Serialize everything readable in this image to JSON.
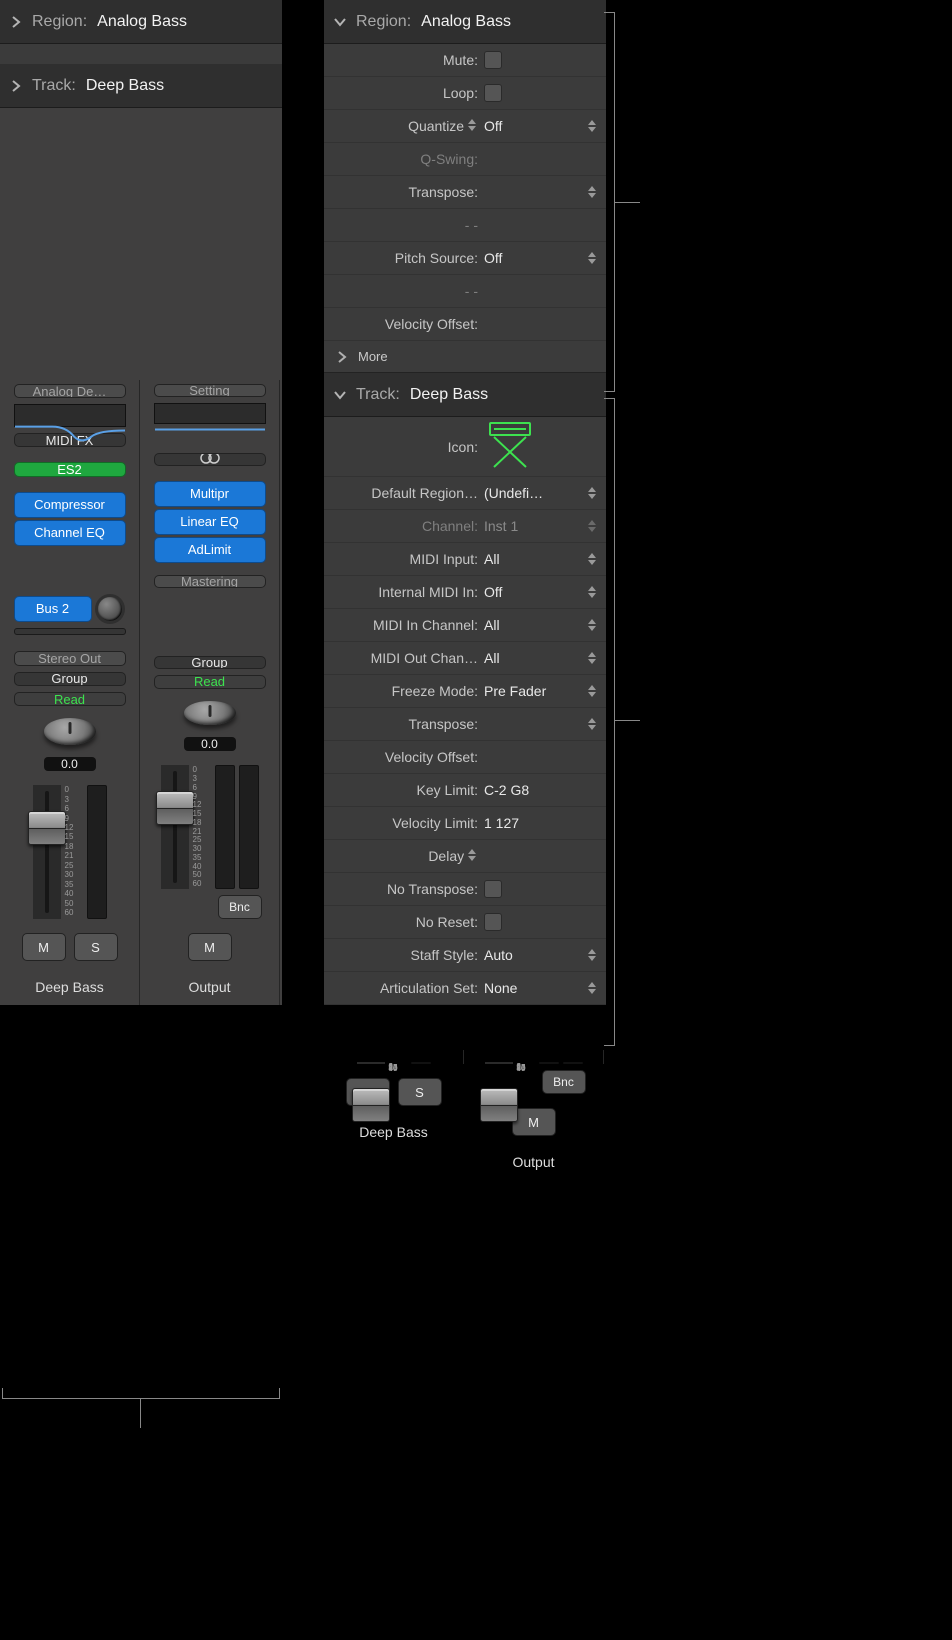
{
  "left": {
    "region_header_label": "Region:",
    "region_header_value": "Analog Bass",
    "track_header_label": "Track:",
    "track_header_value": "Deep Bass",
    "strip1": {
      "setting": "Analog De…",
      "midifx": "MIDI FX",
      "instrument": "ES2",
      "fx1": "Compressor",
      "fx2": "Channel EQ",
      "send1": "Bus 2",
      "output": "Stereo Out",
      "group": "Group",
      "automation": "Read",
      "pan": "0.0",
      "mute": "M",
      "solo": "S",
      "name": "Deep Bass"
    },
    "strip2": {
      "setting": "Setting",
      "fx1": "Multipr",
      "fx2": "Linear EQ",
      "fx3": "AdLimit",
      "mastering": "Mastering",
      "group": "Group",
      "automation": "Read",
      "pan": "0.0",
      "bnc": "Bnc",
      "mute": "M",
      "name": "Output"
    }
  },
  "right": {
    "region_header_label": "Region:",
    "region_header_value": "Analog Bass",
    "region_params": {
      "mute": "Mute:",
      "loop": "Loop:",
      "quantize_label": "Quantize",
      "quantize_value": "Off",
      "qswing": "Q-Swing:",
      "transpose": "Transpose:",
      "dash1": "-  -",
      "pitchsource_label": "Pitch Source:",
      "pitchsource_value": "Off",
      "dash2": "-  -",
      "veloffset": "Velocity Offset:",
      "more": "More"
    },
    "track_header_label": "Track:",
    "track_header_value": "Deep Bass",
    "track_params": {
      "icon": "Icon:",
      "defregion_label": "Default Region…",
      "defregion_value": "(Undefi…",
      "channel_label": "Channel:",
      "channel_value": "Inst 1",
      "midiinput_label": "MIDI Input:",
      "midiinput_value": "All",
      "intmidi_label": "Internal MIDI In:",
      "intmidi_value": "Off",
      "midiinchan_label": "MIDI In Channel:",
      "midiinchan_value": "All",
      "midioutchan_label": "MIDI Out Chan…",
      "midioutchan_value": "All",
      "freeze_label": "Freeze Mode:",
      "freeze_value": "Pre Fader",
      "transpose": "Transpose:",
      "veloffset": "Velocity Offset:",
      "keylimit_label": "Key Limit:",
      "keylimit_value": "C-2  G8",
      "vellimit_label": "Velocity Limit:",
      "vellimit_value": "1   127",
      "delay": "Delay",
      "notranspose": "No Transpose:",
      "noreset": "No Reset:",
      "staff_label": "Staff Style:",
      "staff_value": "Auto",
      "artic_label": "Articulation Set:",
      "artic_value": "None"
    },
    "strip1": {
      "mute": "M",
      "solo": "S",
      "name": "Deep Bass"
    },
    "strip2": {
      "bnc": "Bnc",
      "mute": "M",
      "name": "Output"
    }
  },
  "scale_ticks": [
    "0",
    "3",
    "6",
    "9",
    "12",
    "15",
    "18",
    "21",
    "25",
    "30",
    "35",
    "40",
    "50",
    "60"
  ]
}
